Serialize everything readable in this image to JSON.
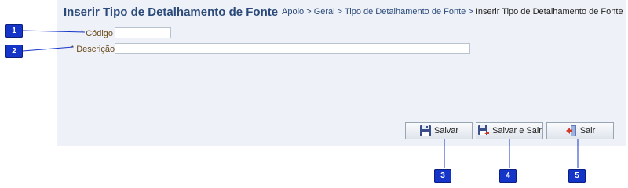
{
  "page": {
    "title": "Inserir Tipo de Detalhamento de Fonte",
    "breadcrumb": {
      "links": [
        "Apoio",
        "Geral",
        "Tipo de Detalhamento de Fonte"
      ],
      "separator": ">",
      "current": "Inserir Tipo de Detalhamento de Fonte"
    }
  },
  "form": {
    "codigo": {
      "label": "Código",
      "required_mark": "*",
      "value": ""
    },
    "descricao": {
      "label": "Descrição",
      "required_mark": "*",
      "value": ""
    }
  },
  "buttons": {
    "salvar": {
      "label": "Salvar",
      "icon": "floppy-disk-icon"
    },
    "salvar_e_sair": {
      "label": "Salvar e Sair",
      "icon": "floppy-disk-exit-icon"
    },
    "sair": {
      "label": "Sair",
      "icon": "exit-door-icon"
    }
  },
  "annotations": [
    "1",
    "2",
    "3",
    "4",
    "5"
  ],
  "colors": {
    "panel_bg": "#eef2f8",
    "title": "#2b4a7a",
    "label": "#6b4a1a",
    "badge_bg": "#1535c9"
  }
}
